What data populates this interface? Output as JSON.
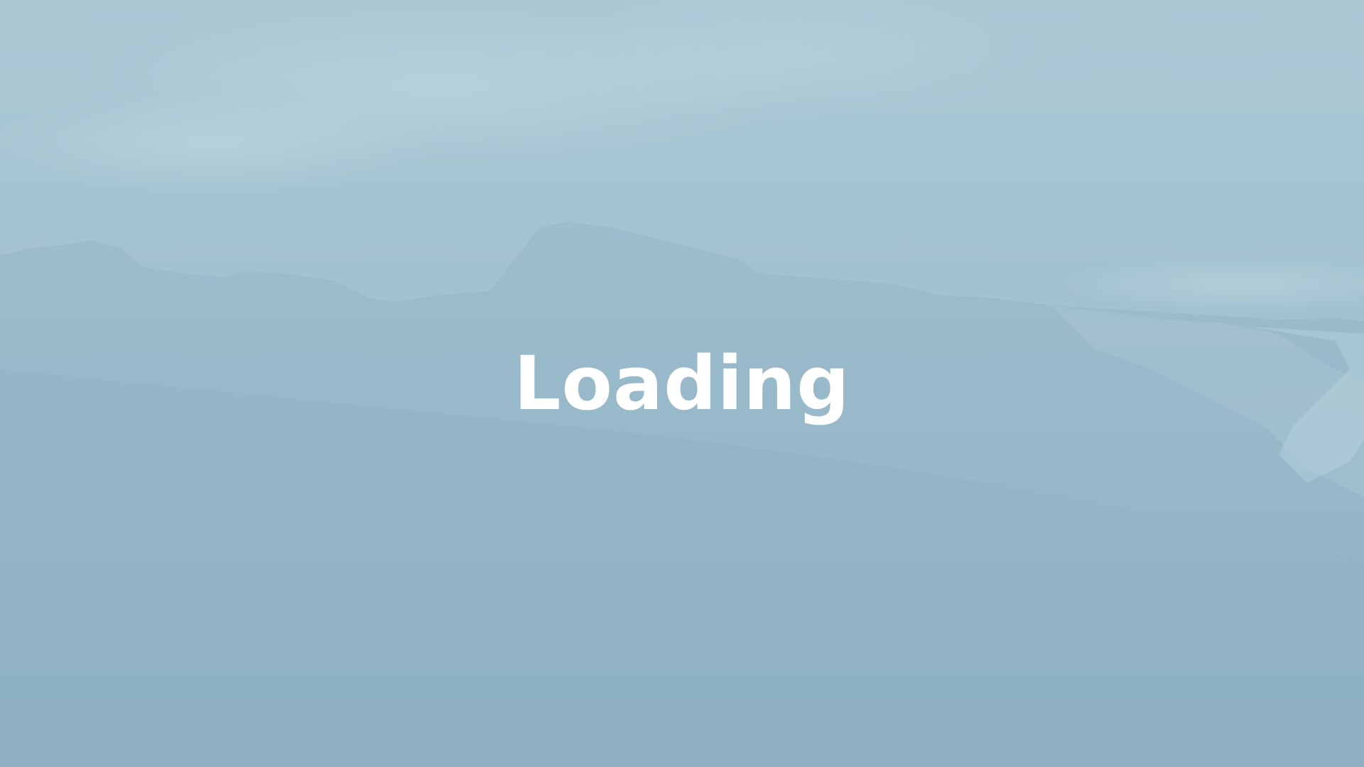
{
  "loading_screen": {
    "label": "Loading",
    "background": "mountain-fog-image",
    "overlay_color": "#9dbccb",
    "text_color": "#ffffff"
  }
}
